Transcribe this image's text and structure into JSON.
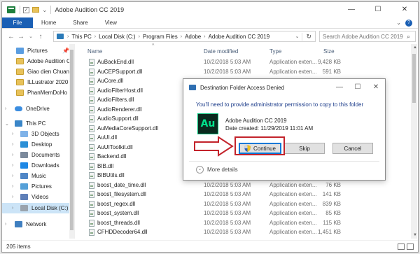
{
  "window": {
    "title": "Adobe Audition CC 2019",
    "controls": {
      "minimize": "—",
      "maximize": "☐",
      "close": "✕"
    }
  },
  "ribbon": {
    "file_tab": "File",
    "tabs": [
      "Home",
      "Share",
      "View"
    ],
    "collapse": "⌄",
    "help": "?"
  },
  "address": {
    "crumbs": [
      "This PC",
      "Local Disk (C:)",
      "Program Files",
      "Adobe",
      "Adobe Audition CC 2019"
    ],
    "dropdown": "⌄",
    "refresh": "↻"
  },
  "search": {
    "placeholder": "Search Adobe Audition CC 2019",
    "icon": "search-icon"
  },
  "sidebar": {
    "items": [
      {
        "label": "Pictures",
        "icon": "folder-icon",
        "pinned": true
      },
      {
        "label": "Adobe Audition CC 201",
        "icon": "folder-icon"
      },
      {
        "label": "Giao dien Chuan",
        "icon": "folder-icon"
      },
      {
        "label": "ILLustrator 2020",
        "icon": "folder-icon"
      },
      {
        "label": "PhanMemDoHo",
        "icon": "folder-icon"
      },
      {
        "label": "OneDrive",
        "icon": "cloud-icon"
      },
      {
        "label": "This PC",
        "icon": "pc-icon"
      },
      {
        "label": "3D Objects",
        "icon": "3d-objects-icon"
      },
      {
        "label": "Desktop",
        "icon": "desktop-icon"
      },
      {
        "label": "Documents",
        "icon": "documents-icon"
      },
      {
        "label": "Downloads",
        "icon": "downloads-icon"
      },
      {
        "label": "Music",
        "icon": "music-icon"
      },
      {
        "label": "Pictures",
        "icon": "pictures-icon"
      },
      {
        "label": "Videos",
        "icon": "videos-icon"
      },
      {
        "label": "Local Disk (C:)",
        "icon": "disk-icon",
        "selected": true
      },
      {
        "label": "Network",
        "icon": "network-icon"
      }
    ]
  },
  "columns": {
    "name": "Name",
    "date": "Date modified",
    "type": "Type",
    "size": "Size"
  },
  "files": [
    {
      "name": "AuBackEnd.dll",
      "date": "10/2/2018 5:03 AM",
      "type": "Application exten...",
      "size": "9,428 KB"
    },
    {
      "name": "AuCEPSupport.dll",
      "date": "10/2/2018 5:03 AM",
      "type": "Application exten...",
      "size": "591 KB"
    },
    {
      "name": "AuCore.dll",
      "date": "10/2/2018 5:03 AM",
      "type": "Application exten...",
      "size": "6,752 KB"
    },
    {
      "name": "AudioFilterHost.dll",
      "date": "10/2/2018 5:03 AM",
      "type": "Application exten...",
      "size": ""
    },
    {
      "name": "AudioFilters.dll",
      "date": "10/2/2018 5:03 AM",
      "type": "Application exten...",
      "size": ""
    },
    {
      "name": "AudioRenderer.dll",
      "date": "",
      "type": "",
      "size": ""
    },
    {
      "name": "AudioSupport.dll",
      "date": "",
      "type": "",
      "size": ""
    },
    {
      "name": "AuMediaCoreSupport.dll",
      "date": "",
      "type": "",
      "size": ""
    },
    {
      "name": "AuUI.dll",
      "date": "",
      "type": "",
      "size": ""
    },
    {
      "name": "AuUIToolkit.dll",
      "date": "",
      "type": "",
      "size": ""
    },
    {
      "name": "Backend.dll",
      "date": "",
      "type": "",
      "size": ""
    },
    {
      "name": "BIB.dll",
      "date": "",
      "type": "",
      "size": ""
    },
    {
      "name": "BIBUtils.dll",
      "date": "",
      "type": "",
      "size": ""
    },
    {
      "name": "boost_date_time.dll",
      "date": "10/2/2018 5:03 AM",
      "type": "Application exten...",
      "size": "76 KB"
    },
    {
      "name": "boost_filesystem.dll",
      "date": "10/2/2018 5:03 AM",
      "type": "Application exten...",
      "size": "141 KB"
    },
    {
      "name": "boost_regex.dll",
      "date": "10/2/2018 5:03 AM",
      "type": "Application exten...",
      "size": "839 KB"
    },
    {
      "name": "boost_system.dll",
      "date": "10/2/2018 5:03 AM",
      "type": "Application exten...",
      "size": "85 KB"
    },
    {
      "name": "boost_threads.dll",
      "date": "10/2/2018 5:03 AM",
      "type": "Application exten...",
      "size": "115 KB"
    },
    {
      "name": "CFHDDecoder64.dll",
      "date": "10/2/2018 5:03 AM",
      "type": "Application exten...",
      "size": "1,451 KB"
    }
  ],
  "status": {
    "count": "205 items"
  },
  "dialog": {
    "title": "Destination Folder Access Denied",
    "message": "You'll need to provide administrator permission to copy to this folder",
    "item_icon_text": "Au",
    "item_name": "Adobe Audition CC 2019",
    "item_date": "Date created: 11/29/2019 11:01 AM",
    "continue_label": "Continue",
    "skip_label": "Skip",
    "cancel_label": "Cancel",
    "more_details": "More details",
    "controls": {
      "minimize": "—",
      "maximize": "☐",
      "close": "✕"
    }
  },
  "colors": {
    "accent": "#1a5fb4",
    "highlight": "#c3232b",
    "selected_bg": "#cce4f7"
  }
}
